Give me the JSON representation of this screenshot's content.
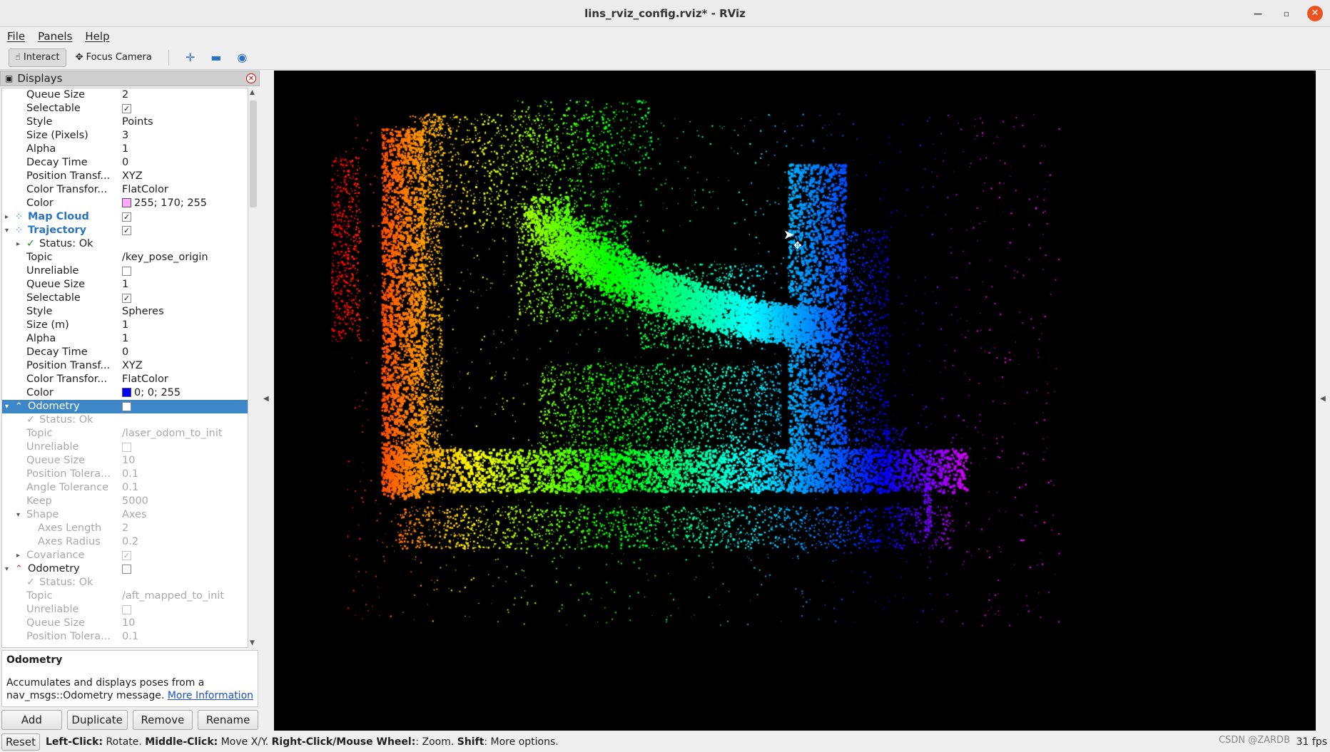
{
  "window": {
    "title": "lins_rviz_config.rviz* - RViz"
  },
  "menu": [
    "File",
    "Panels",
    "Help"
  ],
  "toolbar": {
    "interact": "Interact",
    "focus_camera": "Focus Camera"
  },
  "displays": {
    "title": "Displays",
    "rows": [
      {
        "key": "Queue Size",
        "value": "2"
      },
      {
        "key": "Selectable",
        "check": "✓"
      },
      {
        "key": "Style",
        "value": "Points"
      },
      {
        "key": "Size (Pixels)",
        "value": "3"
      },
      {
        "key": "Alpha",
        "value": "1"
      },
      {
        "key": "Decay Time",
        "value": "0"
      },
      {
        "key": "Position Transf...",
        "value": "XYZ"
      },
      {
        "key": "Color Transfor...",
        "value": "FlatColor"
      },
      {
        "key": "Color",
        "value": "255; 170; 255",
        "swatch": "#ffaaff"
      },
      {
        "key": "Map Cloud",
        "check": "✓"
      },
      {
        "key": "Trajectory",
        "check": "✓"
      },
      {
        "key": "Status: Ok"
      },
      {
        "key": "Topic",
        "value": "/key_pose_origin"
      },
      {
        "key": "Unreliable",
        "check": ""
      },
      {
        "key": "Queue Size",
        "value": "1"
      },
      {
        "key": "Selectable",
        "check": "✓"
      },
      {
        "key": "Style",
        "value": "Spheres"
      },
      {
        "key": "Size (m)",
        "value": "1"
      },
      {
        "key": "Alpha",
        "value": "1"
      },
      {
        "key": "Decay Time",
        "value": "0"
      },
      {
        "key": "Position Transf...",
        "value": "XYZ"
      },
      {
        "key": "Color Transfor...",
        "value": "FlatColor"
      },
      {
        "key": "Color",
        "value": "0; 0; 255",
        "swatch": "#0000ff"
      },
      {
        "key": "Odometry",
        "check": ""
      },
      {
        "key": "Status: Ok"
      },
      {
        "key": "Topic",
        "value": "/laser_odom_to_init"
      },
      {
        "key": "Unreliable",
        "check": ""
      },
      {
        "key": "Queue Size",
        "value": "10"
      },
      {
        "key": "Position Tolera...",
        "value": "0.1"
      },
      {
        "key": "Angle Tolerance",
        "value": "0.1"
      },
      {
        "key": "Keep",
        "value": "5000"
      },
      {
        "key": "Shape",
        "value": "Axes"
      },
      {
        "key": "Axes Length",
        "value": "2"
      },
      {
        "key": "Axes Radius",
        "value": "0.2"
      },
      {
        "key": "Covariance",
        "check": "✓"
      },
      {
        "key": "Odometry",
        "check": ""
      },
      {
        "key": "Status: Ok"
      },
      {
        "key": "Topic",
        "value": "/aft_mapped_to_init"
      },
      {
        "key": "Unreliable",
        "check": ""
      },
      {
        "key": "Queue Size",
        "value": "10"
      },
      {
        "key": "Position Tolera...",
        "value": "0.1"
      }
    ]
  },
  "description": {
    "title": "Odometry",
    "text": "Accumulates and displays poses from a nav_msgs::Odometry message.",
    "link": "More Information"
  },
  "buttons": {
    "add": "Add",
    "duplicate": "Duplicate",
    "remove": "Remove",
    "rename": "Rename"
  },
  "status": {
    "reset": "Reset",
    "b1": "Left-Click:",
    "t1": " Rotate. ",
    "b2": "Middle-Click:",
    "t2": " Move X/Y. ",
    "b3": "Right-Click/Mouse Wheel:",
    "t3": ": Zoom. ",
    "b4": "Shift",
    "t4": ": More options.",
    "fps": "31 fps"
  },
  "watermark": "CSDN @ZARDB"
}
